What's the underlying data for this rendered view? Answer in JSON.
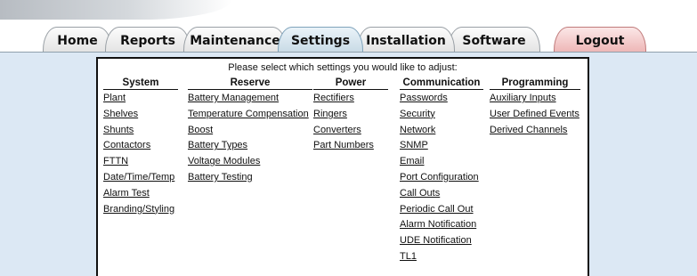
{
  "tabs": [
    {
      "label": "Home"
    },
    {
      "label": "Reports"
    },
    {
      "label": "Maintenance"
    },
    {
      "label": "Settings"
    },
    {
      "label": "Installation"
    },
    {
      "label": "Software"
    },
    {
      "label": "Logout"
    }
  ],
  "active_tab": "Settings",
  "colors": {
    "content_background": "#dce8f4",
    "active_tab": "#c9dbe6",
    "logout_tab": "#eeb7b7"
  },
  "panel": {
    "prompt": "Please select which settings you would like to adjust:",
    "columns": [
      {
        "heading": "System",
        "items": [
          "Plant",
          "Shelves",
          "Shunts",
          "Contactors",
          "FTTN",
          "Date/Time/Temp",
          "Alarm Test",
          "Branding/Styling"
        ]
      },
      {
        "heading": "Reserve",
        "items": [
          "Battery Management",
          "Temperature Compensation",
          "Boost",
          "Battery Types",
          "Voltage Modules",
          "Battery Testing"
        ]
      },
      {
        "heading": "Power",
        "items": [
          "Rectifiers",
          "Ringers",
          "Converters",
          "Part Numbers"
        ]
      },
      {
        "heading": "Communication",
        "items": [
          "Passwords",
          "Security",
          "Network",
          "SNMP",
          "Email",
          "Port Configuration",
          "Call Outs",
          "Periodic Call Out",
          "Alarm Notification",
          "UDE Notification",
          "TL1"
        ]
      },
      {
        "heading": "Programming",
        "items": [
          "Auxiliary Inputs",
          "User Defined Events",
          "Derived Channels"
        ]
      }
    ]
  }
}
